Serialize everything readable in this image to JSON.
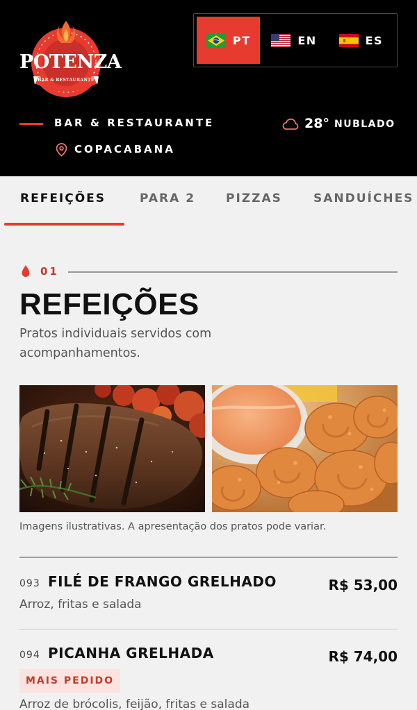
{
  "brand": {
    "logo_text": "POTENZA",
    "logo_subtext": "BAR & RESTAURANTE"
  },
  "languages": [
    {
      "code": "PT",
      "flag": "brazil-flag-icon",
      "active": true
    },
    {
      "code": "EN",
      "flag": "usa-flag-icon",
      "active": false
    },
    {
      "code": "ES",
      "flag": "spain-flag-icon",
      "active": false
    }
  ],
  "header": {
    "tagline": "BAR & RESTAURANTE",
    "location": "COPACABANA",
    "temperature": "28°",
    "weather": "NUBLADO"
  },
  "tabs": [
    {
      "label": "REFEIÇÕES",
      "active": true
    },
    {
      "label": "PARA 2",
      "active": false
    },
    {
      "label": "PIZZAS",
      "active": false
    },
    {
      "label": "SANDUÍCHES",
      "active": false
    }
  ],
  "section": {
    "number": "01",
    "title": "REFEIÇÕES",
    "description": "Pratos individuais servidos com acompanhamentos."
  },
  "photos_note": "Imagens ilustrativas. A apresentação dos pratos pode variar.",
  "items": [
    {
      "code": "093",
      "name": "FILÉ DE FRANGO GRELHADO",
      "price": "R$ 53,00",
      "description": "Arroz, fritas e salada"
    },
    {
      "code": "094",
      "name": "PICANHA GRELHADA",
      "price": "R$ 74,00",
      "badge": "MAIS PEDIDO",
      "description": "Arroz de brócolis, feijão, fritas e salada"
    }
  ],
  "colors": {
    "accent": "#e63b2e",
    "header_bg": "#000000",
    "page_bg": "#f1f1f1"
  }
}
